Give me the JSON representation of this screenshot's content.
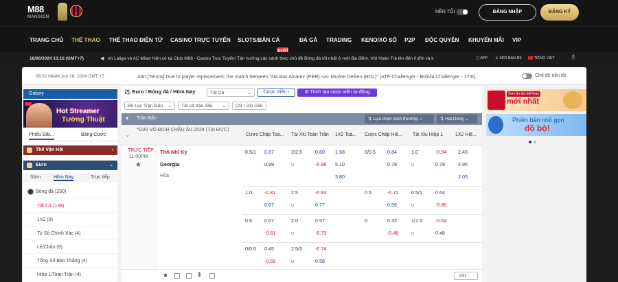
{
  "header": {
    "logo_text": "M88",
    "logo_sub": "MANSION",
    "dark_mode_label": "NỀN TỐI",
    "login_label": "ĐĂNG NHẬP",
    "register_label": "ĐĂNG KÝ"
  },
  "nav": [
    "TRANG CHỦ",
    "THỂ THAO",
    "THỂ THAO ĐIỆN TỬ",
    "CASINO TRỰC TUYẾN",
    "SLOTS/BẮN CÁ",
    "ĐÁ GÀ",
    "TRADING",
    "KENO/XỔ SỐ",
    "P2P",
    "ĐỘC QUYỀN",
    "KHUYẾN MÃI",
    "VIP"
  ],
  "nav_badge": "mới",
  "ticker": {
    "datetime": "18/06/2024 13:16 (GMT+7)",
    "message": "nh Laliga và AC Milan hiện có tại Club M88 - Casino Trực Tuyến! Tận hưởng các sảnh theo chủ đề Bóng đá tốt nhất ở một địa điểm. Với Hoàn Trả lên đến 0,8% và k",
    "app": "APP",
    "invite": "MỜI BẠN BÈ",
    "lang": "TIẾNG VIỆT"
  },
  "topbar": {
    "clock": "08:52:06AM Jun 18, 2024 GMT +7",
    "attention": "Attn:[Tennis] Due to player replacement, the match between \"Nicolas Alvarez (PER) -vs- Murkel Dellien (BOL)\" [ATP Challenger - Bolivia Challenger - 17/6].",
    "dark_label": "Chế độ nền tối"
  },
  "sidebar": {
    "galaxy": "Galaxy",
    "streamer1": "Hot Streamer",
    "streamer2": "Tướng Thuật",
    "tabs": [
      "Phiếu Đặt...",
      "Bảng Cược"
    ],
    "olympic": "Thể Vận Hội",
    "euro": "Euro",
    "euro_tabs": [
      "Sớm",
      "Hôm Nay",
      "Trực tiếp"
    ],
    "items": [
      {
        "label": "Bóng đá (250)"
      },
      {
        "label": "Tất Cả (138)"
      },
      {
        "label": "1X2 (8)"
      },
      {
        "label": "Tỷ Số Chính Xác (4)"
      },
      {
        "label": "Lẻ/Chẵn (9)"
      },
      {
        "label": "Tổng Số Bàn Thắng (4)"
      },
      {
        "label": "Hiệp 1/Toàn Trận (4)"
      }
    ]
  },
  "center": {
    "breadcrumb": "Euro / Bóng đá / Hôm Nay",
    "select_all": "Tất Cả",
    "btn_cuoc_xien": "Cược Xiên",
    "btn_tao_cuoc": "Trình tạo cược xiên tự động",
    "filter": "Bộ Lọc Trận Đấu",
    "all_matches": "Tất cả trận đấu",
    "count": "(23 / 23) Giải",
    "group": "Trận Đấu",
    "sort": "Lựa chọn bình thường",
    "lines": "Hai Dòng",
    "league": "*GIẢI VÔ ĐỊCH CHÂU ÂU 2024 (TẠI ĐỨC)",
    "cols": [
      "Cược Chấp Toà...",
      "Tài Xỉu Toàn Trận",
      "1X2 Toà...",
      "Cược Chấp Hiệ...",
      "Tài Xỉu Hiệp 1",
      "1X2 Hiệ..."
    ],
    "live": "TRỰC TIẾP",
    "time": "11:00PM",
    "home": "Thổ Nhĩ Kỳ",
    "away": "Georgia",
    "draw": "Hòa",
    "rows": [
      [
        "0.5/1",
        "0.87",
        "2/2.5",
        "0.80",
        "1.68",
        "0/0.5",
        "0.84",
        "1.0",
        "-0.94",
        "2.40"
      ],
      [
        "",
        "0.99",
        "u",
        "-0.96",
        "5.10",
        "",
        "0.78",
        "u",
        "0.78",
        "4.95"
      ],
      [
        "",
        "",
        "",
        "",
        "3.80",
        "",
        "",
        "",
        "",
        "2.05"
      ],
      [
        "1.0",
        "-0.81",
        "2.5",
        "-0.93",
        "",
        "0.5",
        "-0.72",
        "0.5/1",
        "0.64",
        ""
      ],
      [
        "",
        "0.67",
        "u",
        "0.77",
        "",
        "",
        "0.56",
        "u",
        "-0.80",
        ""
      ],
      [
        "0.5",
        "0.67",
        "2.0",
        "0.57",
        "",
        "0",
        "0.32",
        "1/1.5",
        "-0.64",
        ""
      ],
      [
        "",
        "-0.81",
        "u",
        "-0.73",
        "",
        "",
        "-0.48",
        "u",
        "0.48",
        ""
      ],
      [
        "0/0.5",
        "0.45",
        "2.5/3",
        "-0.74",
        "",
        "",
        "",
        "",
        "",
        ""
      ],
      [
        "",
        "-0.59",
        "u",
        "0.58",
        "",
        "",
        "",
        "",
        "",
        ""
      ]
    ],
    "footer_count": "231"
  },
  "right": {
    "ban1_tag": "Xem tin tức thể thao",
    "ban1_title": "mới nhất",
    "ban2_t1": "Phiên bản nhỏ gọn",
    "ban2_t2": "đồ bộ!"
  }
}
